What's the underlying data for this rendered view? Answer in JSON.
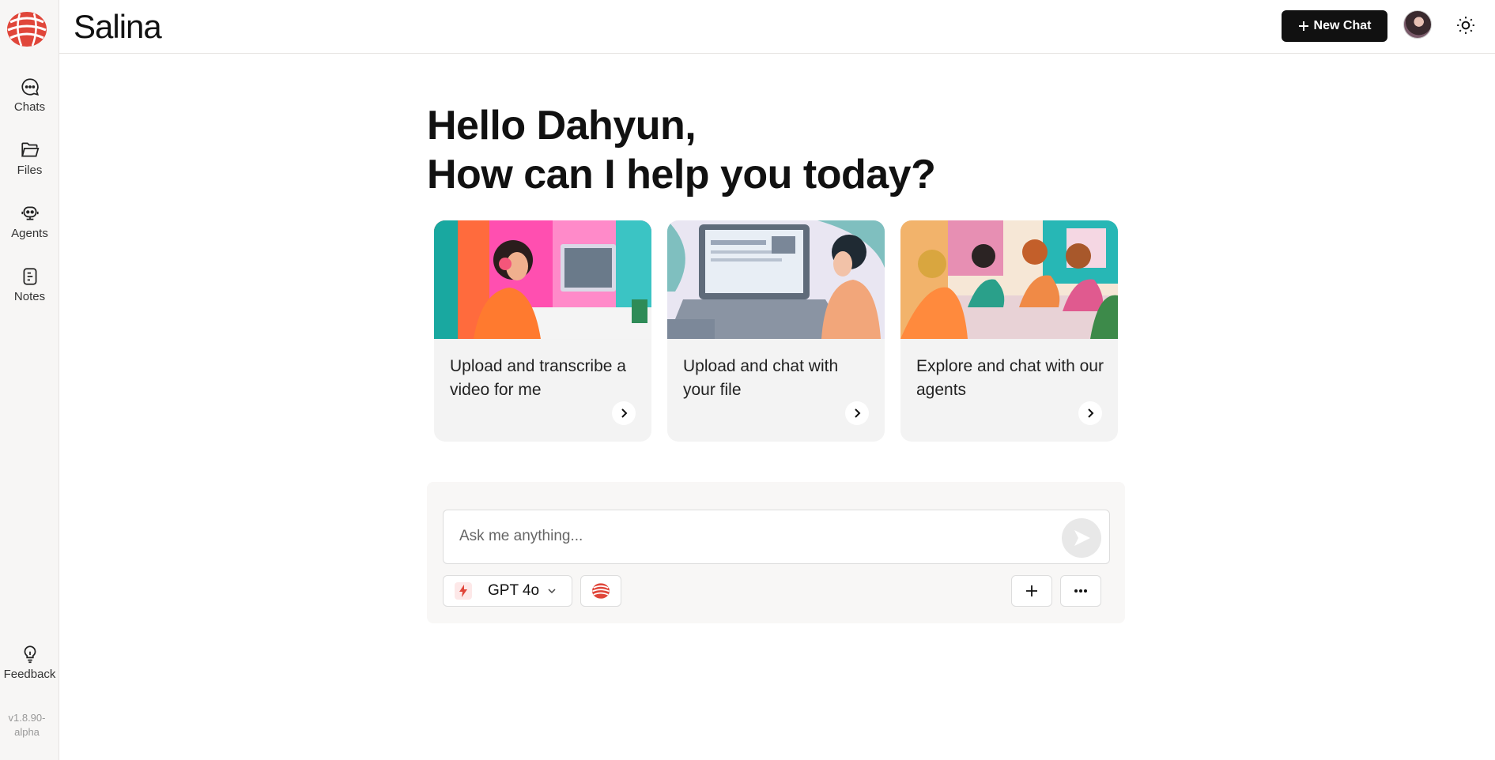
{
  "app": {
    "name": "Salina",
    "version": "v1.8.90-alpha"
  },
  "sidebar": {
    "items": [
      {
        "label": "Chats",
        "icon": "chat-bubble-icon"
      },
      {
        "label": "Files",
        "icon": "folder-icon"
      },
      {
        "label": "Agents",
        "icon": "agent-icon"
      },
      {
        "label": "Notes",
        "icon": "note-icon"
      }
    ],
    "feedback": {
      "label": "Feedback",
      "icon": "lightbulb-icon"
    }
  },
  "header": {
    "new_chat_label": "New Chat"
  },
  "greeting": {
    "line1": "Hello Dahyun,",
    "line2": "How can I help you today?"
  },
  "cards": [
    {
      "text": "Upload and transcribe a video for me"
    },
    {
      "text": "Upload and chat with your file"
    },
    {
      "text": "Explore and chat with our agents"
    }
  ],
  "composer": {
    "placeholder": "Ask me anything...",
    "model": "GPT 4o"
  },
  "colors": {
    "accent": "#e0463a",
    "dark": "#111111"
  }
}
